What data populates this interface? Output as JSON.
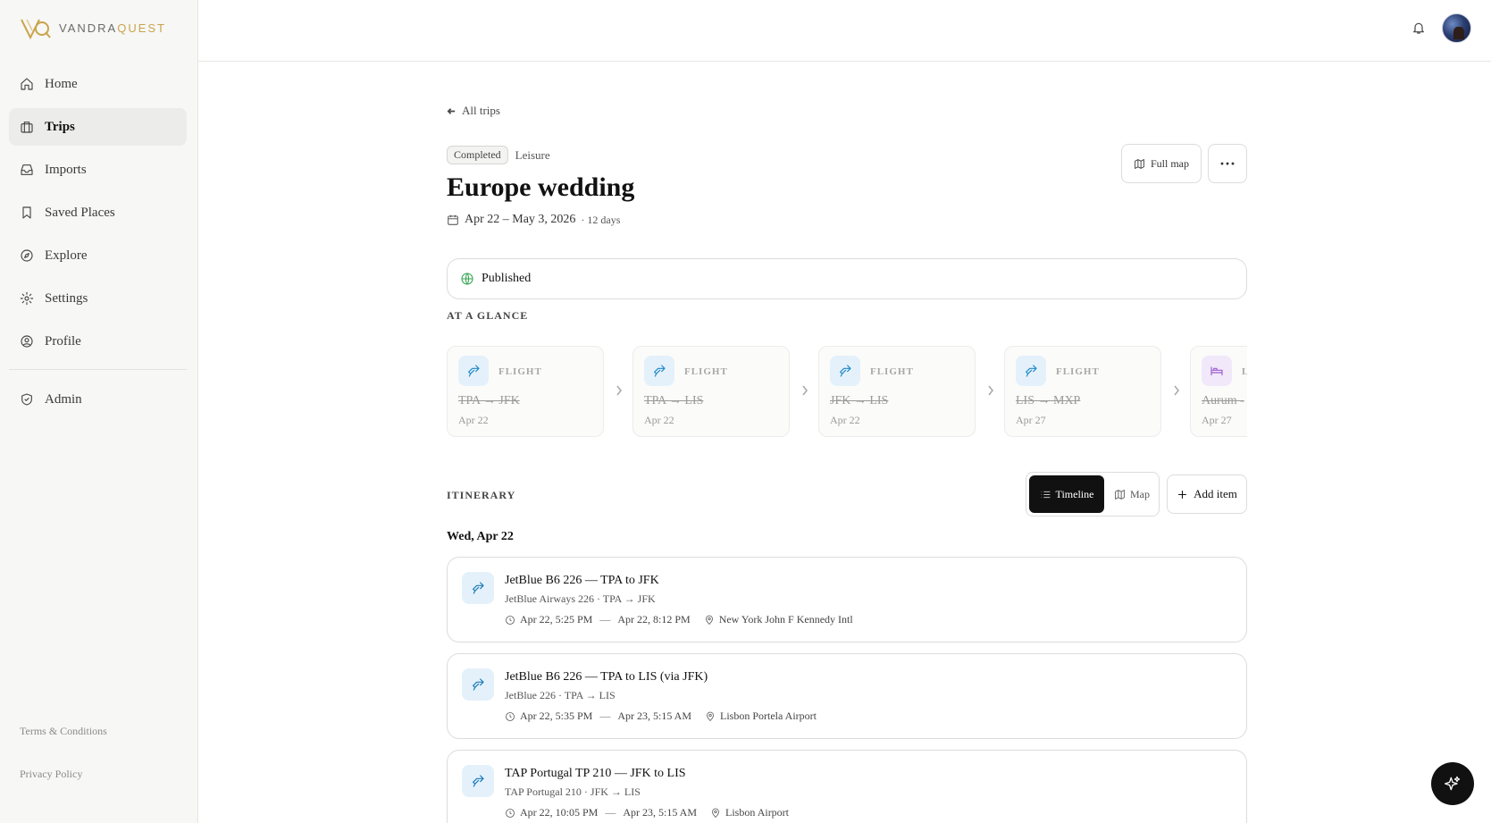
{
  "brand": {
    "name_part1": "VANDRA",
    "name_part2": "QUEST",
    "accent": "#c9a44c"
  },
  "sidebar": {
    "items": [
      {
        "label": "Home",
        "icon": "home-icon"
      },
      {
        "label": "Trips",
        "icon": "suitcase-icon",
        "active": true
      },
      {
        "label": "Imports",
        "icon": "inbox-icon"
      },
      {
        "label": "Saved Places",
        "icon": "bookmark-icon"
      },
      {
        "label": "Explore",
        "icon": "compass-icon"
      },
      {
        "label": "Settings",
        "icon": "gear-icon"
      },
      {
        "label": "Profile",
        "icon": "user-circle-icon"
      }
    ],
    "admin": {
      "label": "Admin",
      "icon": "shield-check-icon"
    },
    "footer": {
      "terms": "Terms & Conditions",
      "privacy": "Privacy Policy"
    }
  },
  "header": {
    "bell_icon": "bell-icon",
    "avatar": "user-avatar"
  },
  "trip": {
    "back_label": "All trips",
    "status_badge": "Completed",
    "category": "Leisure",
    "title": "Europe wedding",
    "dates": "Apr 22 – May 3, 2026",
    "duration": "· 12 days",
    "full_map_label": "Full map",
    "more_label": "···",
    "published_label": "Published"
  },
  "glance": {
    "heading": "AT A GLANCE",
    "cards": [
      {
        "type": "FLIGHT",
        "route": "TPA → JFK",
        "date": "Apr 22",
        "icon": "plane-icon"
      },
      {
        "type": "FLIGHT",
        "route": "TPA → LIS",
        "date": "Apr 22",
        "icon": "plane-icon"
      },
      {
        "type": "FLIGHT",
        "route": "JFK → LIS",
        "date": "Apr 22",
        "icon": "plane-icon"
      },
      {
        "type": "FLIGHT",
        "route": "LIS → MXP",
        "date": "Apr 27",
        "icon": "plane-icon"
      },
      {
        "type": "L",
        "route": "Aurum -",
        "date": "Apr 27",
        "icon": "bed-icon"
      }
    ]
  },
  "itinerary": {
    "heading": "ITINERARY",
    "view_timeline": "Timeline",
    "view_map": "Map",
    "add_item": "Add item",
    "day_heading": "Wed, Apr 22",
    "items": [
      {
        "title": "JetBlue B6 226 — TPA to JFK",
        "subtitle": "JetBlue Airways 226 · TPA → JFK",
        "start": "Apr 22, 5:25 PM",
        "end": "Apr 22, 8:12 PM",
        "location": "New York John F Kennedy Intl"
      },
      {
        "title": "JetBlue B6 226 — TPA to LIS (via JFK)",
        "subtitle": "JetBlue 226 · TPA → LIS",
        "start": "Apr 22, 5:35 PM",
        "end": "Apr 23, 5:15 AM",
        "location": "Lisbon Portela Airport"
      },
      {
        "title": "TAP Portugal TP 210 — JFK to LIS",
        "subtitle": "TAP Portugal 210 · JFK → LIS",
        "start": "Apr 22, 10:05 PM",
        "end": "Apr 23, 5:15 AM",
        "location": "Lisbon Airport"
      }
    ]
  },
  "fab": {
    "icon": "sparkle-icon"
  }
}
